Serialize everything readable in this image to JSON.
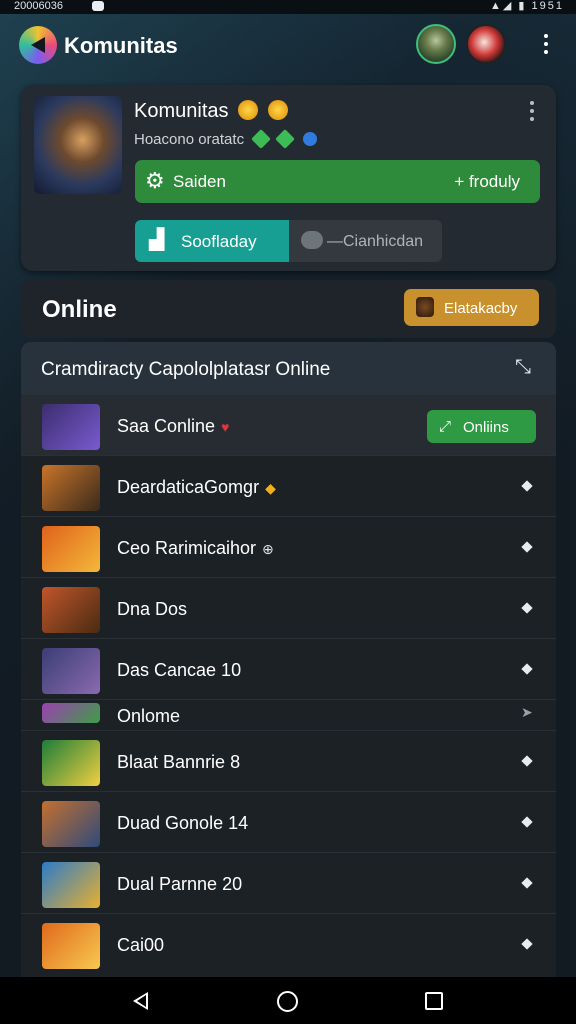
{
  "status_bar": {
    "time": "20006036",
    "icons": "▲◢ ▮ 1951"
  },
  "app_bar": {
    "title": "Komunitas"
  },
  "header_card": {
    "title": "Komunitas",
    "subtitle": "Hoacono oratatc",
    "primary_button": {
      "label": "Saiden",
      "right_label": "+ froduly"
    },
    "secondary_buttons": [
      {
        "label": "Soofladay"
      },
      {
        "label": "—Cianhicdan"
      }
    ]
  },
  "online_section": {
    "title": "Online",
    "action_label": "Elatakacby"
  },
  "list": {
    "header": "Cramdiracty Capololplatasr Online",
    "items": [
      {
        "name": "Saa Conline",
        "mark": "♥",
        "button_label": "Onliins",
        "thumb_colors": [
          "#3b2e6e",
          "#7a5ad0"
        ]
      },
      {
        "name": "DeardaticaGomgr",
        "mark": "◆",
        "thumb_colors": [
          "#c9742a",
          "#3a2a1a"
        ]
      },
      {
        "name": "Ceo Rarimicaihor",
        "mark": "⊕",
        "thumb_colors": [
          "#e0621c",
          "#f4b83a"
        ]
      },
      {
        "name": "Dna Dos",
        "mark": "",
        "thumb_colors": [
          "#c0562a",
          "#4a2b12"
        ]
      },
      {
        "name": "Das Cancae 10",
        "mark": "",
        "thumb_colors": [
          "#3a3e74",
          "#8a6ab0"
        ]
      },
      {
        "name": "Onlome",
        "mark": "",
        "thumb_colors": [
          "#9c3fb0",
          "#3d9e48"
        ]
      },
      {
        "name": "Blaat Bannrie 8",
        "mark": "",
        "thumb_colors": [
          "#1d7d3a",
          "#f0d040"
        ]
      },
      {
        "name": "Duad Gonole 14",
        "mark": "",
        "thumb_colors": [
          "#c4702e",
          "#2f4a7a"
        ]
      },
      {
        "name": "Dual Parnne 20",
        "mark": "",
        "thumb_colors": [
          "#2c7bc8",
          "#e8b030"
        ]
      },
      {
        "name": "Cai00",
        "mark": "",
        "thumb_colors": [
          "#e06a1c",
          "#f8c850"
        ]
      }
    ]
  }
}
